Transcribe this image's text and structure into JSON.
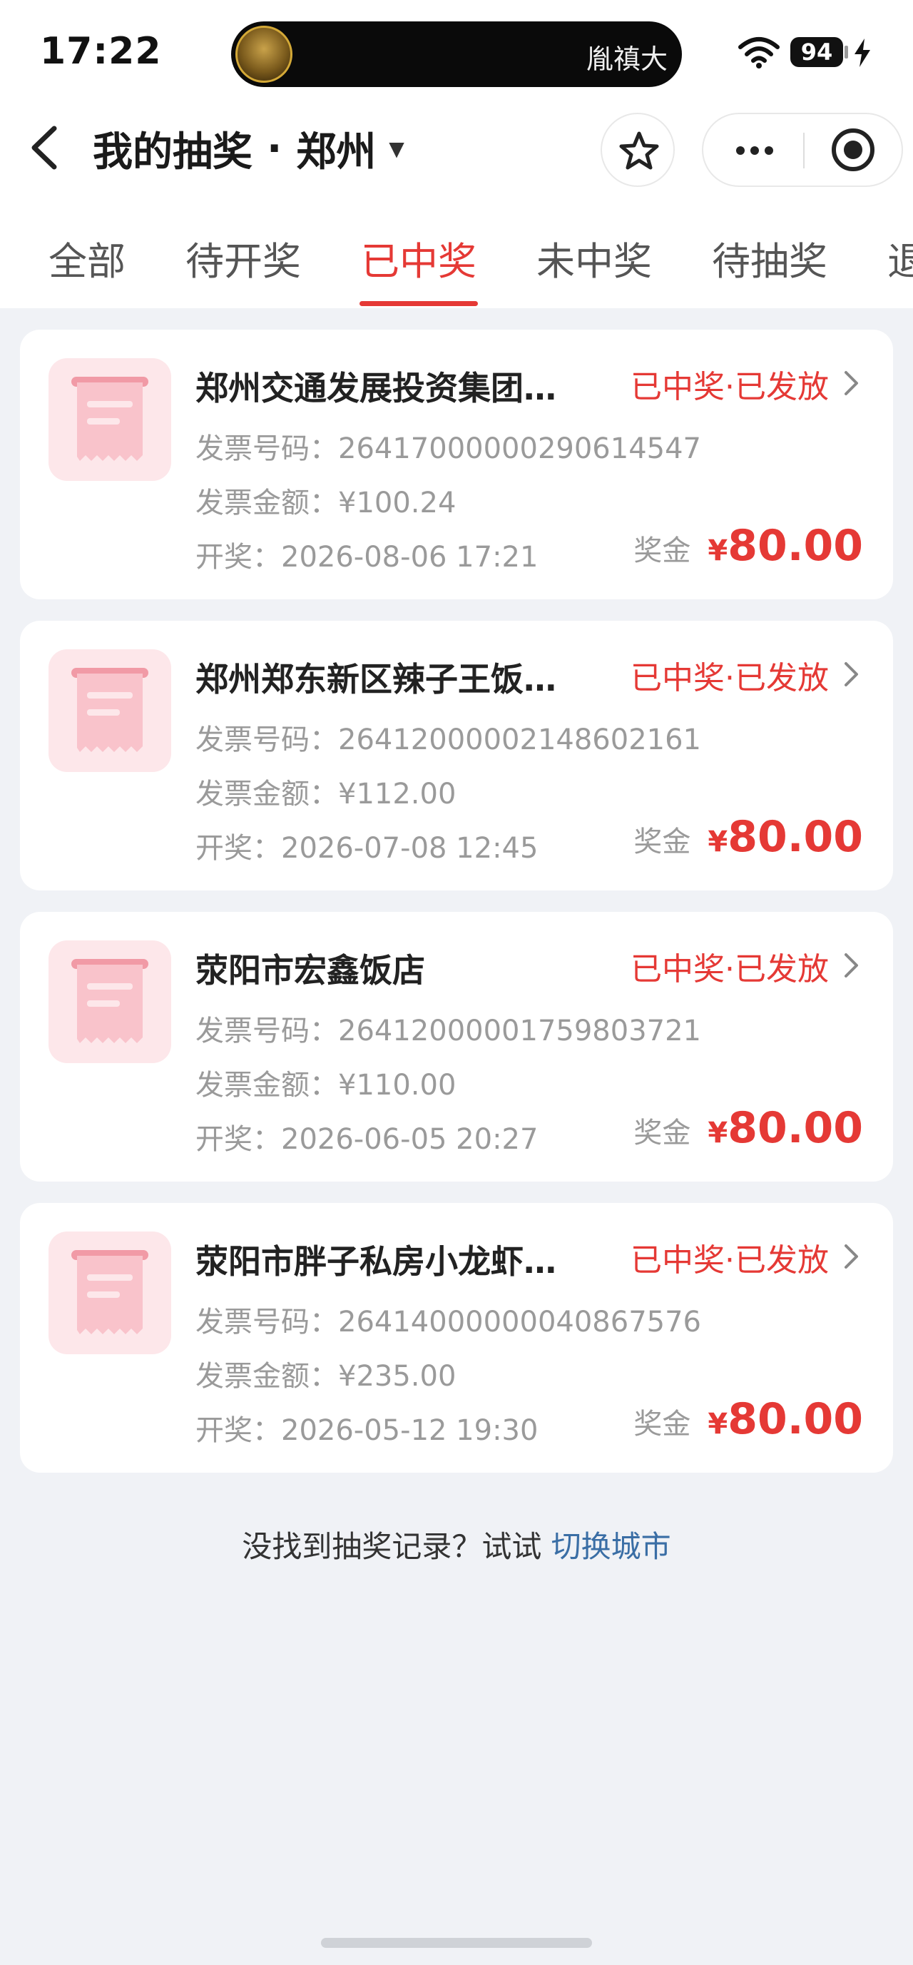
{
  "status_bar": {
    "time": "17:22",
    "island_text": "胤禛大",
    "battery": "94"
  },
  "nav": {
    "title": "我的抽奖",
    "separator": "·",
    "city": "郑州",
    "caret": "▼"
  },
  "tabs": [
    {
      "label": "全部"
    },
    {
      "label": "待开奖"
    },
    {
      "label": "已中奖"
    },
    {
      "label": "未中奖"
    },
    {
      "label": "待抽奖"
    },
    {
      "label": "退"
    }
  ],
  "active_tab": "已中奖",
  "cards": [
    {
      "merchant": "郑州交通发展投资集团…",
      "status": "已中奖·已发放",
      "invoice_no_label": "发票号码：",
      "invoice_no": "26417000000290614547",
      "invoice_amount_label": "发票金额：",
      "invoice_amount": "¥100.24",
      "draw_label": "开奖：",
      "draw_time": "2026-08-06 17:21",
      "prize_label": "奖金",
      "prize_currency": "¥",
      "prize_amount": "80.00"
    },
    {
      "merchant": "郑州郑东新区辣子王饭…",
      "status": "已中奖·已发放",
      "invoice_no_label": "发票号码：",
      "invoice_no": "26412000002148602161",
      "invoice_amount_label": "发票金额：",
      "invoice_amount": "¥112.00",
      "draw_label": "开奖：",
      "draw_time": "2026-07-08 12:45",
      "prize_label": "奖金",
      "prize_currency": "¥",
      "prize_amount": "80.00"
    },
    {
      "merchant": "荥阳市宏鑫饭店",
      "status": "已中奖·已发放",
      "invoice_no_label": "发票号码：",
      "invoice_no": "26412000001759803721",
      "invoice_amount_label": "发票金额：",
      "invoice_amount": "¥110.00",
      "draw_label": "开奖：",
      "draw_time": "2026-06-05 20:27",
      "prize_label": "奖金",
      "prize_currency": "¥",
      "prize_amount": "80.00"
    },
    {
      "merchant": "荥阳市胖子私房小龙虾…",
      "status": "已中奖·已发放",
      "invoice_no_label": "发票号码：",
      "invoice_no": "26414000000040867576",
      "invoice_amount_label": "发票金额：",
      "invoice_amount": "¥235.00",
      "draw_label": "开奖：",
      "draw_time": "2026-05-12 19:30",
      "prize_label": "奖金",
      "prize_currency": "¥",
      "prize_amount": "80.00"
    }
  ],
  "footer": {
    "text": "没找到抽奖记录？试试 ",
    "link": "切换城市"
  },
  "colors": {
    "accent_red": "#e53935",
    "link_blue": "#3a6ea5",
    "page_bg": "#f0f2f6"
  }
}
